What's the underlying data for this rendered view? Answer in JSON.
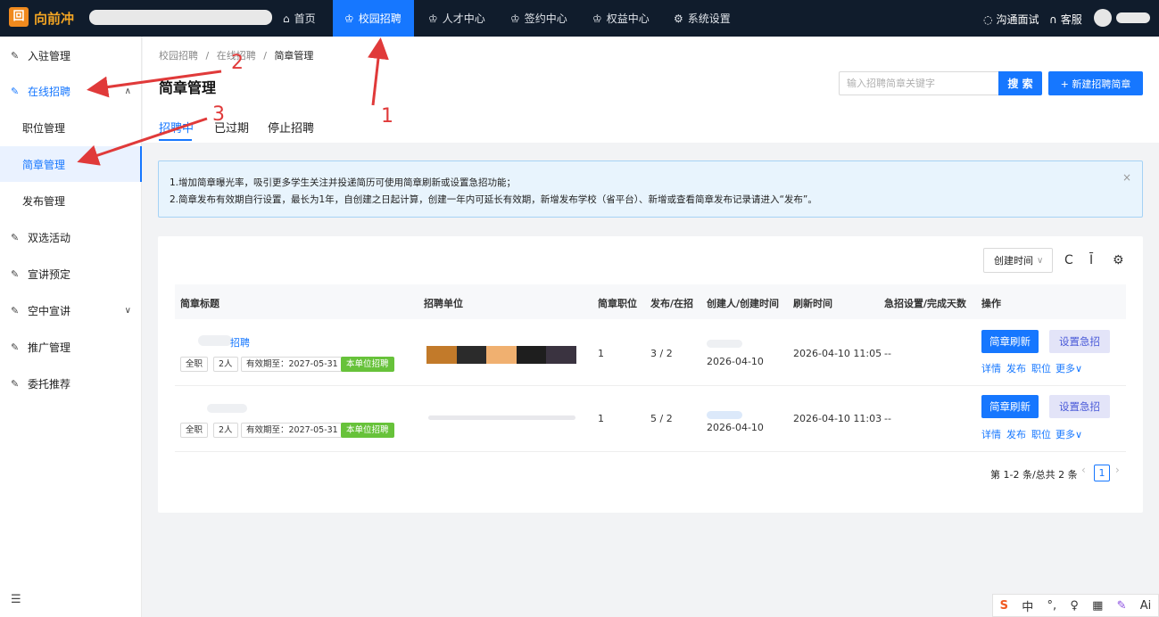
{
  "topbar": {
    "logo_glyph": "回",
    "brand": "向前冲",
    "nav": [
      {
        "label": "首页",
        "icon": "home-icon",
        "glyph": "⌂"
      },
      {
        "label": "校园招聘",
        "icon": "building-icon",
        "glyph": "♔",
        "active": true
      },
      {
        "label": "人才中心",
        "icon": "building-icon",
        "glyph": "♔"
      },
      {
        "label": "签约中心",
        "icon": "building-icon",
        "glyph": "♔"
      },
      {
        "label": "权益中心",
        "icon": "building-icon",
        "glyph": "♔"
      },
      {
        "label": "系统设置",
        "icon": "gear-icon",
        "glyph": "⚙"
      }
    ],
    "interview": "沟通面试",
    "service": "客服"
  },
  "sidebar": {
    "items": [
      {
        "label": "入驻管理"
      },
      {
        "label": "在线招聘"
      },
      {
        "label": "职位管理"
      },
      {
        "label": "简章管理"
      },
      {
        "label": "发布管理"
      },
      {
        "label": "双选活动"
      },
      {
        "label": "宣讲预定"
      },
      {
        "label": "空中宣讲"
      },
      {
        "label": "推广管理"
      },
      {
        "label": "委托推荐"
      }
    ],
    "collapse_glyph": "☰"
  },
  "header": {
    "breadcrumb": [
      "校园招聘",
      "在线招聘",
      "简章管理"
    ],
    "separator": "/",
    "title": "简章管理",
    "search_placeholder": "输入招聘简章关键字",
    "search_label": "搜 索",
    "new_label": "+ 新建招聘简章",
    "tabs": [
      "招聘中",
      "已过期",
      "停止招聘"
    ]
  },
  "notice": {
    "line1": "1.增加简章曝光率，吸引更多学生关注并投递简历可使用简章刷新或设置急招功能；",
    "line2": "2.简章发布有效期自行设置，最长为1年，自创建之日起计算，创建一年内可延长有效期，新增发布学校（省平台）、新增或查看简章发布记录请进入“发布”。",
    "close": "×"
  },
  "toolbar": {
    "sort_label": "创建时间",
    "sort_chevron": "∨",
    "refresh_glyph": "C",
    "density_glyph": "I",
    "settings_glyph": "⚙"
  },
  "table": {
    "columns": [
      "简章标题",
      "招聘单位",
      "简章职位",
      "发布/在招",
      "创建人/创建时间",
      "刷新时间",
      "急招设置/完成天数",
      "操作"
    ],
    "rows": [
      {
        "title_fragment": "招聘",
        "tags": [
          "全职",
          "2人",
          "有效期至：2027-05-31"
        ],
        "badge": "本单位招聘",
        "positions": "1",
        "pub_ratio": "3 / 2",
        "created": "2026-04-10",
        "refreshed": "2026-04-10 11:05",
        "urgent": "--",
        "refresh_btn": "简章刷新",
        "urgent_btn": "设置急招",
        "links": [
          "详情",
          "发布",
          "职位",
          "更多∨"
        ]
      },
      {
        "title_fragment": "",
        "tags": [
          "全职",
          "2人",
          "有效期至：2027-05-31"
        ],
        "badge": "本单位招聘",
        "positions": "1",
        "pub_ratio": "5 / 2",
        "created": "2026-04-10",
        "refreshed": "2026-04-10 11:03",
        "urgent": "--",
        "refresh_btn": "简章刷新",
        "urgent_btn": "设置急招",
        "links": [
          "详情",
          "发布",
          "职位",
          "更多∨"
        ]
      }
    ]
  },
  "pagination": {
    "summary": "第 1-2 条/总共 2 条",
    "prev": "‹",
    "current": "1",
    "next": "›"
  },
  "ime": [
    "S",
    "中",
    "°,",
    "♀",
    "▦",
    "✎",
    "Ai"
  ],
  "annotations": {
    "labels": [
      "1",
      "2",
      "3"
    ],
    "color": "#e03a3a"
  },
  "colors": {
    "accent": "#1677ff",
    "topbar": "#101c2c",
    "tag_green": "#67c23a"
  }
}
